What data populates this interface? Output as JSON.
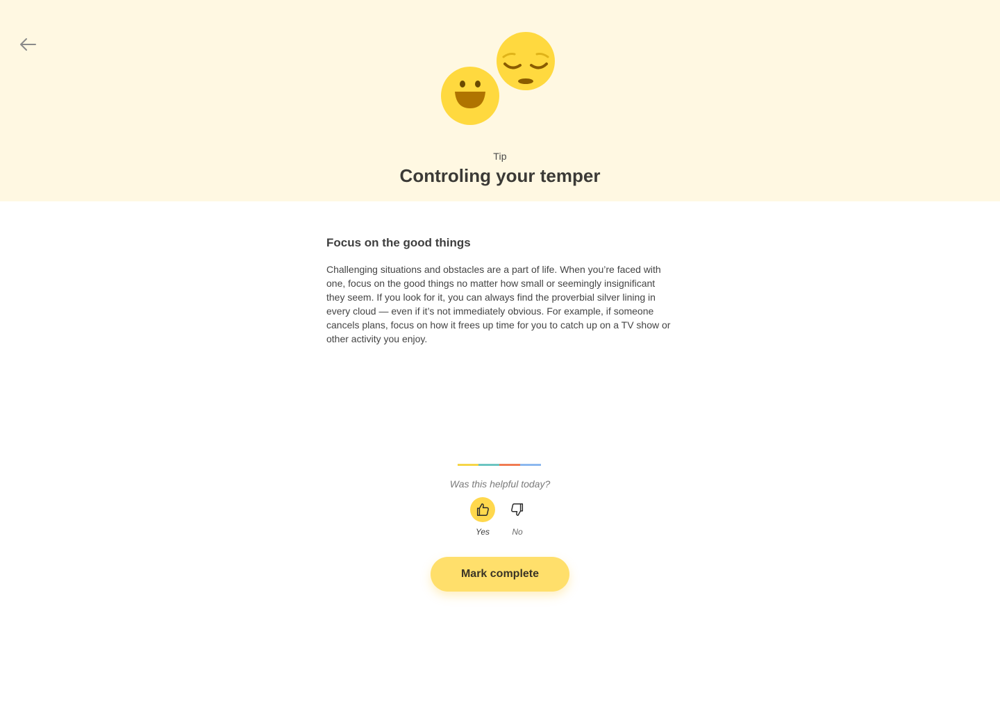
{
  "header": {
    "eyebrow": "Tip",
    "title": "Controling your temper",
    "back_icon": "arrow-left-icon",
    "illustration_icons": [
      "smiling-face-icon",
      "pensive-face-icon"
    ],
    "background_color": "#fff8e2"
  },
  "content": {
    "heading": "Focus on the good things",
    "body": "Challenging situations and obstacles are a part of life. When you’re faced with one, focus on the good things no matter how small or seemingly insignificant they seem. If you look for it, you can always find the proverbial silver lining in every cloud — even if it’s not immediately obvious. For example, if someone cancels plans, focus on how it frees up time for you to catch up on a TV show or other activity you enjoy."
  },
  "divider_colors": [
    "#f5d547",
    "#6cc5c1",
    "#f07b52",
    "#8cb8ef"
  ],
  "feedback": {
    "question": "Was this helpful today?",
    "yes_label": "Yes",
    "no_label": "No",
    "selected": "Yes",
    "yes_icon": "thumbs-up-icon",
    "no_icon": "thumbs-down-icon"
  },
  "actions": {
    "mark_complete_label": "Mark complete",
    "accent_color": "#ffdf6b"
  }
}
